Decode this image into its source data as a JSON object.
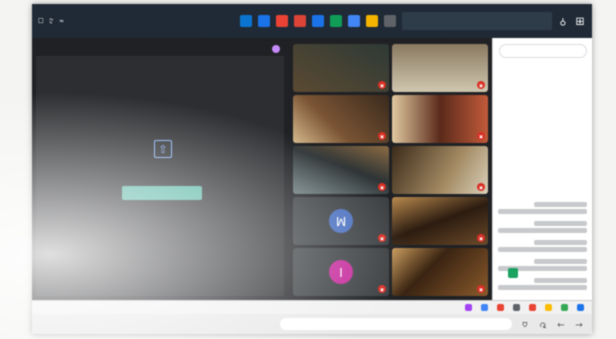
{
  "browser": {
    "url": "",
    "bookmarks": [
      {
        "label": "",
        "color": "#1a73e8"
      },
      {
        "label": "",
        "color": "#34a853"
      },
      {
        "label": "",
        "color": "#fbbc04"
      },
      {
        "label": "",
        "color": "#ea4335"
      },
      {
        "label": "",
        "color": "#5f6368"
      },
      {
        "label": "",
        "color": "#ea4335"
      },
      {
        "label": "",
        "color": "#4285f4"
      },
      {
        "label": "",
        "color": "#a142f4"
      }
    ]
  },
  "banner": {
    "text": "",
    "action": "",
    "close": ""
  },
  "chat": {
    "title": "",
    "messages": [
      {
        "author": ""
      },
      {
        "author": ""
      },
      {
        "author": ""
      },
      {
        "author": ""
      },
      {
        "author": ""
      }
    ],
    "input_placeholder": ""
  },
  "participants": [
    {
      "name": "",
      "initial": "",
      "avatar_color": ""
    },
    {
      "name": "",
      "initial": "I",
      "avatar_color": "#c5299b"
    },
    {
      "name": "",
      "initial": "",
      "avatar_color": ""
    },
    {
      "name": "",
      "initial": "M",
      "avatar_color": "#4a6fc0"
    },
    {
      "name": "",
      "initial": "",
      "avatar_color": ""
    },
    {
      "name": "",
      "initial": "",
      "avatar_color": ""
    },
    {
      "name": "",
      "initial": "",
      "avatar_color": ""
    },
    {
      "name": "",
      "initial": "",
      "avatar_color": ""
    },
    {
      "name": "",
      "initial": "",
      "avatar_color": ""
    },
    {
      "name": "",
      "initial": "",
      "avatar_color": ""
    }
  ],
  "presentation": {
    "title": "",
    "button": "",
    "presenter_label": ""
  },
  "taskbar": {
    "search_placeholder": "",
    "apps": [
      "#5f6368",
      "#f4b400",
      "#4285f4",
      "#0f9d58",
      "#1a73e8",
      "#db4437",
      "#ea4335",
      "#1a73e8",
      "#0b74d1"
    ]
  }
}
